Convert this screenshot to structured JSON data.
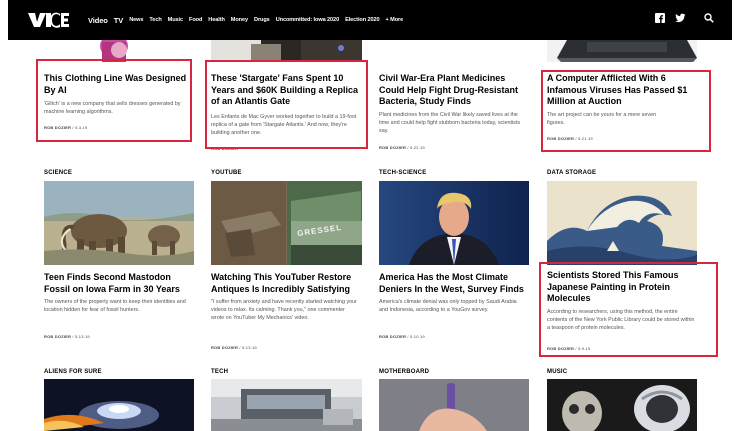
{
  "nav": {
    "items": [
      "Video",
      "TV",
      "News",
      "Tech",
      "Music",
      "Food",
      "Health",
      "Money",
      "Drugs",
      "Uncommitted: Iowa 2020",
      "Election 2020",
      "+ More"
    ]
  },
  "articles": [
    {
      "category": "",
      "title": "This Clothing Line Was Designed By AI",
      "dek": "'Glitch' is a new company that sells dresses generated by machine learning algorithms.",
      "author": "ROB DOZIER",
      "date": "5.3.19",
      "highlighted": true
    },
    {
      "category": "",
      "title": "These 'Stargate' Fans Spent 10 Years and $60K Building a Replica of an Atlantis Gate",
      "dek": "Les Enfants de Mac Gyver worked together to build a 19-foot replica of a gate from 'Stargate Atlantis.' And now, they're building another one.",
      "author": "ROB DOZIER",
      "date": "",
      "highlighted": true
    },
    {
      "category": "",
      "title": "Civil War-Era Plant Medicines Could Help Fight Drug-Resistant Bacteria, Study Finds",
      "dek": "Plant medicines from the Civil War likely saved lives at the time and could help fight stubborn bacteria today, scientists say.",
      "author": "ROB DOZIER",
      "date": "5.22.19",
      "highlighted": false
    },
    {
      "category": "",
      "title": "A Computer Afflicted With 6 Infamous Viruses Has Passed $1 Million at Auction",
      "dek": "The art project can be yours for a mere seven figures.",
      "author": "ROB DOZIER",
      "date": "5.21.19",
      "highlighted": true
    },
    {
      "category": "SCIENCE",
      "title": "Teen Finds Second Mastodon Fossil on Iowa Farm in 30 Years",
      "dek": "The owners of the property want to keep their identities and location hidden for fear of fossil hunters.",
      "author": "ROB DOZIER",
      "date": "5.13.19",
      "highlighted": false
    },
    {
      "category": "YOUTUBE",
      "title": "Watching This YouTuber Restore Antiques Is Incredibly Satisfying",
      "dek": "\"I suffer from anxiety and have recently started watching your videos to relax. Its calming. Thank you,\" one commenter wrote on YouTuber My Mechanics' video.",
      "author": "ROB DOZIER",
      "date": "5.13.19",
      "highlighted": false
    },
    {
      "category": "TECH-SCIENCE",
      "title": "America Has the Most Climate Deniers In the West, Survey Finds",
      "dek": "America's climate denial was only topped by Saudi Arabia and Indonesia, according to a YouGov survey.",
      "author": "ROB DOZIER",
      "date": "5.10.19",
      "highlighted": false
    },
    {
      "category": "DATA STORAGE",
      "title": "Scientists Stored This Famous Japanese Painting in Protein Molecules",
      "dek": "According to researchers, using this method, the entire contents of the New York Public Library could be stored within a teaspoon of protein molecules.",
      "author": "ROB DOZIER",
      "date": "5.9.19",
      "highlighted": true
    }
  ],
  "row3_categories": [
    "ALIENS FOR SURE",
    "TECH",
    "MOTHERBOARD",
    "MUSIC"
  ],
  "image_overlay_text": "GRESSEL"
}
